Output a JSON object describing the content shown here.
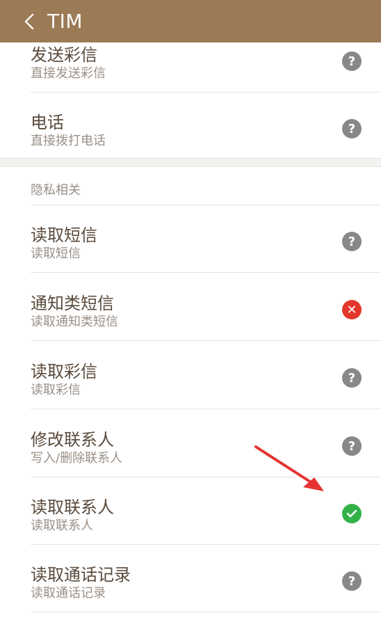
{
  "header": {
    "title": "TIM"
  },
  "group1_items": [
    {
      "name": "发送彩信",
      "desc": "直接发送彩信",
      "status": "unknown"
    },
    {
      "name": "电话",
      "desc": "直接拨打电话",
      "status": "unknown"
    }
  ],
  "privacy_section": {
    "title": "隐私相关",
    "items": [
      {
        "name": "读取短信",
        "desc": "读取短信",
        "status": "unknown"
      },
      {
        "name": "通知类短信",
        "desc": "读取通知类短信",
        "status": "deny"
      },
      {
        "name": "读取彩信",
        "desc": "读取彩信",
        "status": "unknown"
      },
      {
        "name": "修改联系人",
        "desc": "写入/删除联系人",
        "status": "unknown"
      },
      {
        "name": "读取联系人",
        "desc": "读取联系人",
        "status": "allow"
      },
      {
        "name": "读取通话记录",
        "desc": "读取通话记录",
        "status": "unknown"
      }
    ]
  },
  "colors": {
    "header": "#9b7a56",
    "allow": "#33b24a",
    "deny": "#e2372a",
    "unknown": "#888888",
    "annotation_arrow": "#e53232"
  }
}
